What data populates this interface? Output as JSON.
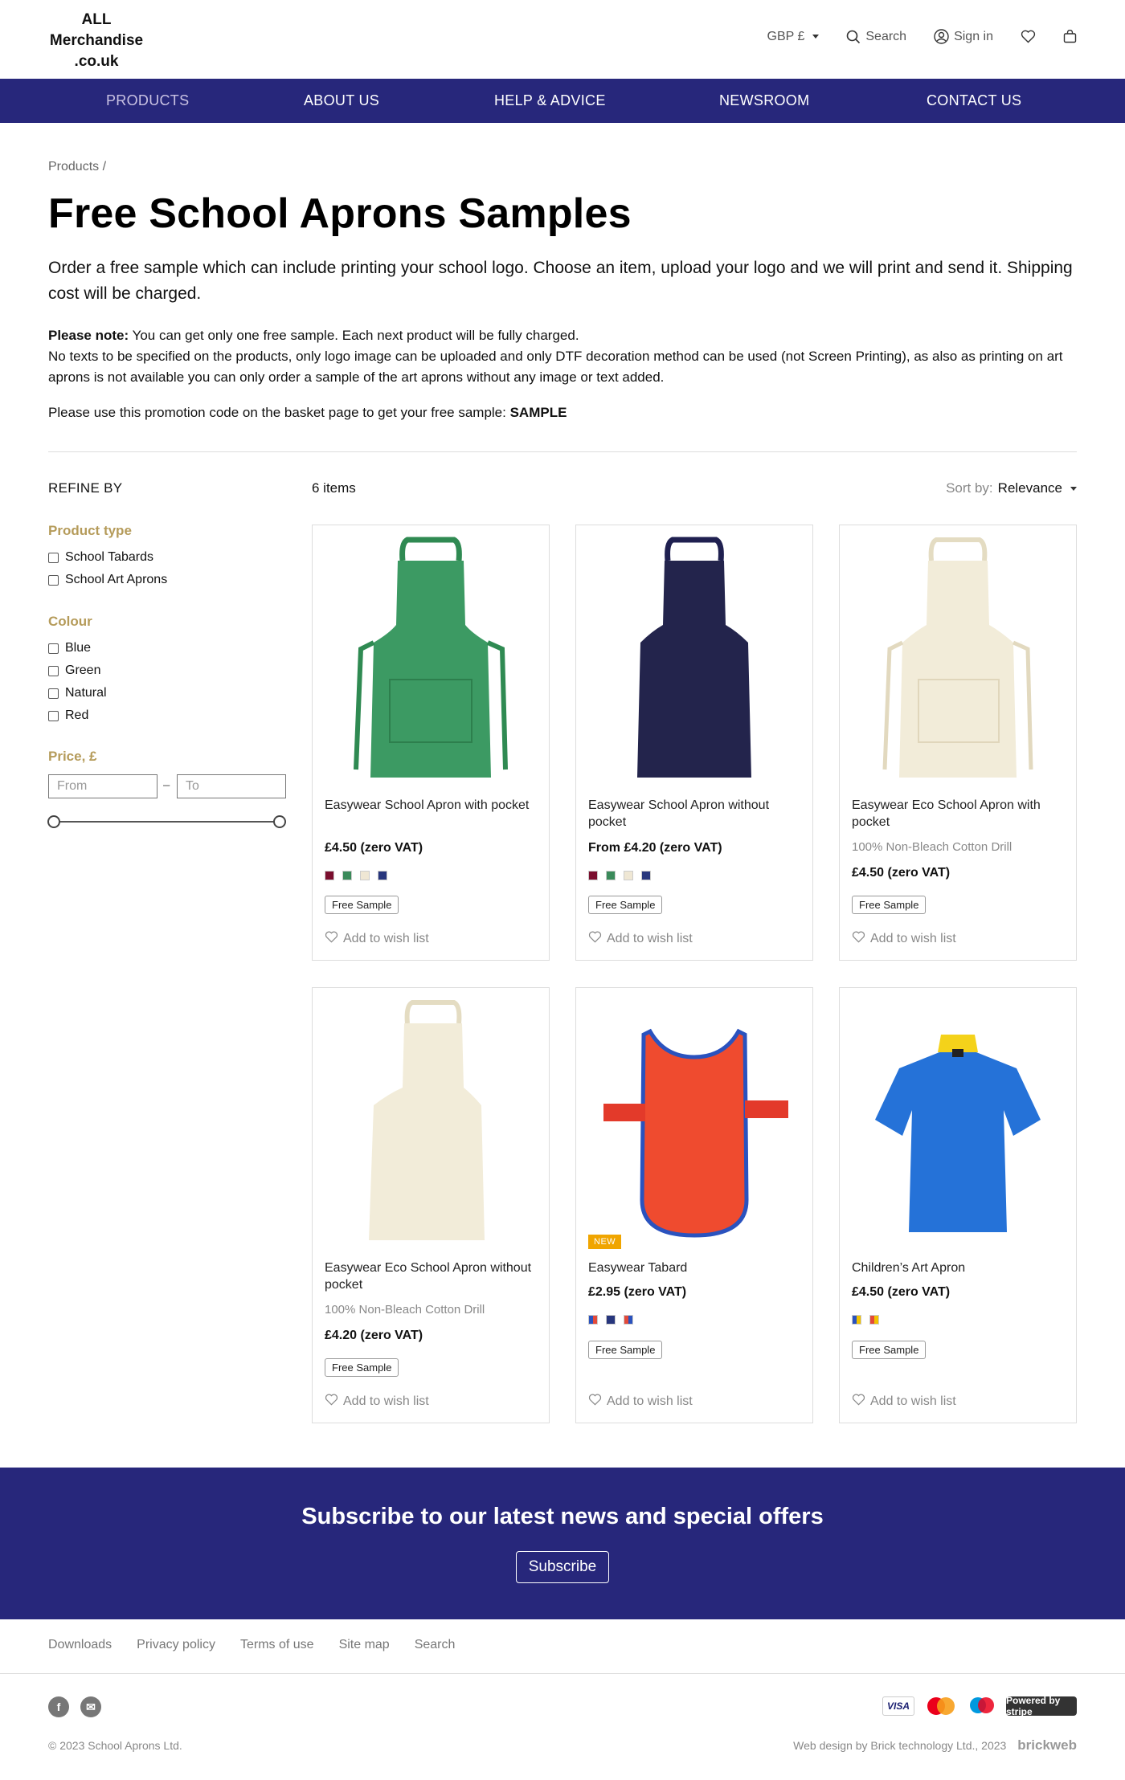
{
  "header": {
    "logo_line1": "ALL",
    "logo_line2": "Merchandise",
    "logo_line3": ".co.uk",
    "currency": "GBP £",
    "search": "Search",
    "sign_in": "Sign in"
  },
  "nav": {
    "items": [
      "PRODUCTS",
      "ABOUT US",
      "HELP & ADVICE",
      "NEWSROOM",
      "CONTACT US"
    ],
    "active": "PRODUCTS"
  },
  "intro": {
    "breadcrumb": "Products /",
    "title": "Free School Aprons Samples",
    "lead": "Order a free sample which can include printing your school logo. Choose an item, upload your logo and we will print and send it. Shipping cost will be charged.",
    "note_label": "Please note:",
    "note_line1": " You can get only one free sample. Each next product will be fully charged.",
    "note_line2": "No texts to be specified on the products, only logo image can be uploaded and only DTF decoration method can be used (not Screen Printing), as also as printing on art aprons is not available you can only order a sample of the art aprons without any image or text added.",
    "promo_text": "Please use this promotion code on the basket page to get your free sample: ",
    "promo_code": "SAMPLE"
  },
  "filters": {
    "title": "REFINE BY",
    "product_type_title": "Product type",
    "product_types": [
      "School Tabards",
      "School Art Aprons"
    ],
    "colour_title": "Colour",
    "colours": [
      "Blue",
      "Green",
      "Natural",
      "Red"
    ],
    "price_title": "Price, £",
    "from_placeholder": "From",
    "to_placeholder": "To",
    "dash": "–"
  },
  "listing": {
    "count": "6 items",
    "sort_label": "Sort by:",
    "sort_value": "Relevance"
  },
  "products": [
    {
      "name": "Easywear School Apron with pocket",
      "sub": "",
      "price": "£4.50 (zero VAT)",
      "badge": "Free Sample",
      "wish": "Add to wish list",
      "new": "",
      "swatches": [
        "#7a0e2e",
        "#3a8a5a",
        "#efe7d4",
        "#27367d"
      ]
    },
    {
      "name": "Easywear School Apron without pocket",
      "sub": "",
      "price": "From £4.20 (zero VAT)",
      "badge": "Free Sample",
      "wish": "Add to wish list",
      "new": "",
      "swatches": [
        "#7a0e2e",
        "#3a8a5a",
        "#efe7d4",
        "#27367d"
      ]
    },
    {
      "name": "Easywear Eco School Apron with pocket",
      "sub": "100% Non-Bleach Cotton Drill",
      "price": "£4.50 (zero VAT)",
      "badge": "Free Sample",
      "wish": "Add to wish list",
      "new": "",
      "swatches": []
    },
    {
      "name": "Easywear Eco School Apron without pocket",
      "sub": "100% Non-Bleach Cotton Drill",
      "price": "£4.20 (zero VAT)",
      "badge": "Free Sample",
      "wish": "Add to wish list",
      "new": "",
      "swatches": []
    },
    {
      "name": "Easywear Tabard",
      "sub": "",
      "price": "£2.95 (zero VAT)",
      "badge": "Free Sample",
      "wish": "Add to wish list",
      "new": "NEW",
      "swatches": [
        "#2a52be",
        "#27367d",
        "#e34a3a"
      ]
    },
    {
      "name": "Children’s Art Apron",
      "sub": "",
      "price": "£4.50 (zero VAT)",
      "badge": "Free Sample",
      "wish": "Add to wish list",
      "new": "",
      "swatches": [
        "#2a52be",
        "#f2c200"
      ]
    }
  ],
  "subscribe": {
    "title": "Subscribe to our latest news and special offers",
    "button": "Subscribe"
  },
  "footer": {
    "links": [
      "Downloads",
      "Privacy policy",
      "Terms of use",
      "Site map",
      "Search"
    ],
    "copyright": "© 2023 School Aprons Ltd.",
    "credit": "Web design by Brick technology Ltd., 2023",
    "credit_logo": "brickweb",
    "visa": "VISA",
    "stripe": "Powered by stripe"
  },
  "colors": {
    "brand": "#27277b",
    "facet": "#b59b5a",
    "new_badge": "#f0a500"
  }
}
